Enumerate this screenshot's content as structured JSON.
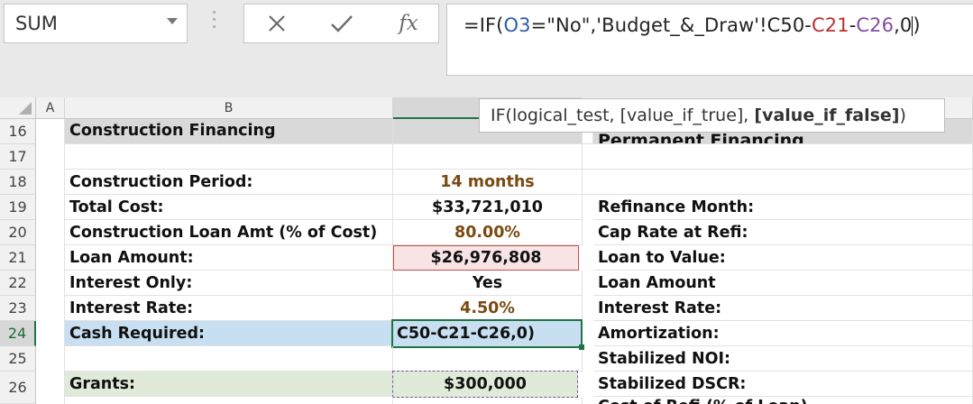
{
  "name_box": {
    "value": "SUM"
  },
  "formula_bar": {
    "eq_if": "=IF(",
    "ref_o3": "O3",
    "cond": "=\"No\",'Budget_&_Draw'!C50-",
    "ref_c21": "C21",
    "dash": "-",
    "ref_c26": "C26",
    "tail": ",0",
    "close": ")",
    "colors": {
      "o3": "#2f5dab",
      "c21": "#b5332e",
      "c26": "#7e4fa2"
    }
  },
  "tooltip": {
    "prefix": "IF(logical_test, [value_if_true], ",
    "bold": "[value_if_false]",
    "suffix": ")"
  },
  "columns": {
    "a": "A",
    "b": "B"
  },
  "rows": [
    "16",
    "17",
    "18",
    "19",
    "20",
    "21",
    "22",
    "23",
    "24",
    "25",
    "26"
  ],
  "partial_header_text": "Permanent Financing",
  "cells": {
    "b16": "Construction Financing",
    "b18": "Construction Period:",
    "c18": "14 months",
    "b19": "Total Cost:",
    "c19": "$33,721,010",
    "b20": "Construction Loan Amt (% of Cost)",
    "c20": "80.00%",
    "b21": "Loan Amount:",
    "c21": "$26,976,808",
    "b22": "Interest Only:",
    "c22": "Yes",
    "b23": "Interest Rate:",
    "c23": "4.50%",
    "b24": "Cash Required:",
    "c24": "C50-C21-C26,0)",
    "b26": "Grants:",
    "c26": "$300,000",
    "d19": "Refinance Month:",
    "d20": "Cap Rate at Refi:",
    "d21": "Loan to Value:",
    "d22": "Loan Amount",
    "d23": "Interest Rate:",
    "d24": "Amortization:",
    "d25": "Stabilized NOI:",
    "d26": "Stabilized DSCR:",
    "d27_partial": "Cost of Refi (% of Loan)"
  },
  "fills": {
    "section_header": "#d9d9d9",
    "cash_required": "#c7dff0",
    "grants": "#dfead9",
    "loan_amount": "#f8e4e4",
    "selection": "#217346"
  }
}
